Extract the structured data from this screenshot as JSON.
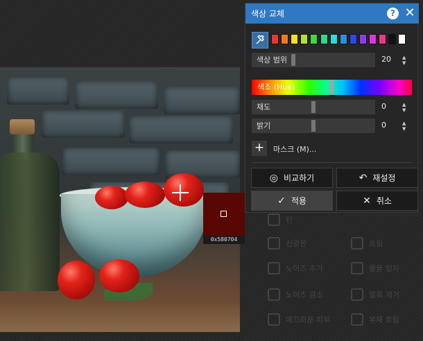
{
  "dialog": {
    "title": "색상 교체",
    "help_icon": "?",
    "close_icon": "✕",
    "swatch_colors": [
      "#e23a3a",
      "#f07a1a",
      "#f2e020",
      "#b6e030",
      "#40d840",
      "#30d888",
      "#30d8d8",
      "#2f8ee0",
      "#3048e0",
      "#8e3ee0",
      "#d838d8",
      "#e83a8a",
      "#111111",
      "#ffffff"
    ],
    "color_range": {
      "label": "색상 범위",
      "value": "20"
    },
    "hue": {
      "label": "색조 (Hue)"
    },
    "saturation": {
      "label": "채도",
      "value": "0"
    },
    "brightness": {
      "label": "밝기",
      "value": "0"
    },
    "mask": {
      "label": "마스크 (M)..."
    },
    "buttons": {
      "compare": "비교하기",
      "reset": "재설정",
      "apply": "적용",
      "cancel": "취소"
    }
  },
  "picker": {
    "hex": "0x580704",
    "color": "#580704"
  },
  "background_menu": [
    {
      "label": "틴"
    },
    {
      "label": "신광판"
    },
    {
      "label": "흐림"
    },
    {
      "label": "노이즈 추가"
    },
    {
      "label": "물을 입자"
    },
    {
      "label": "노이즈 감소"
    },
    {
      "label": "얼룩 제거"
    },
    {
      "label": "매끄러운 피부"
    },
    {
      "label": "부채 흐림"
    }
  ]
}
